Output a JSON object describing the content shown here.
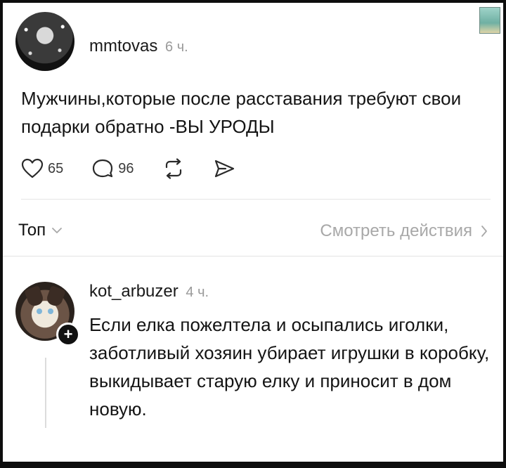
{
  "post": {
    "username": "mmtovas",
    "time": "6 ч.",
    "text": "Мужчины,которые после расставания требуют свои подарки обратно -ВЫ УРОДЫ",
    "likes": "65",
    "comments": "96"
  },
  "filter": {
    "sort_label": "Топ",
    "view_actions_label": "Смотреть действия"
  },
  "comment": {
    "username": "kot_arbuzer",
    "time": "4 ч.",
    "text": "Если елка пожелтела и осыпались иголки, заботливый хозяин убирает игрушки в коробку, выкидывает старую елку и приносит в дом новую.",
    "follow_symbol": "+"
  },
  "icons": {
    "like": "heart-icon",
    "comment": "comment-bubble-icon",
    "repost": "repost-icon",
    "share": "send-icon",
    "sort_dropdown": "chevron-down-icon",
    "view_actions": "chevron-right-icon"
  },
  "colors": {
    "text": "#141414",
    "muted": "#9a9a9a",
    "divider": "#e6e6e6",
    "background": "#ffffff"
  }
}
